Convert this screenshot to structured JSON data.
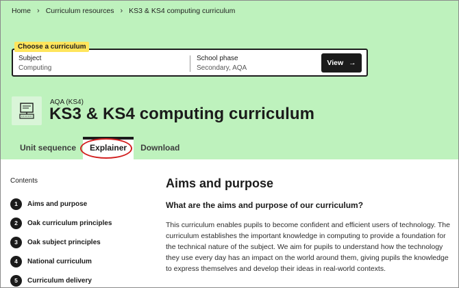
{
  "breadcrumb": {
    "items": [
      "Home",
      "Curriculum resources",
      "KS3 & KS4 computing curriculum"
    ],
    "separator": "›"
  },
  "chooser": {
    "tag": "Choose a curriculum",
    "subject_label": "Subject",
    "subject_value": "Computing",
    "phase_label": "School phase",
    "phase_value": "Secondary, AQA",
    "view_label": "View",
    "view_icon": "→"
  },
  "header": {
    "icon": "computer-icon",
    "exam_board": "AQA (KS4)",
    "title": "KS3 & KS4 computing curriculum"
  },
  "tabs": [
    {
      "label": "Unit sequence",
      "active": false
    },
    {
      "label": "Explainer",
      "active": true
    },
    {
      "label": "Download",
      "active": false
    }
  ],
  "sidebar": {
    "title": "Contents",
    "items": [
      {
        "num": "1",
        "label": "Aims and purpose"
      },
      {
        "num": "2",
        "label": "Oak curriculum principles"
      },
      {
        "num": "3",
        "label": "Oak subject principles"
      },
      {
        "num": "4",
        "label": "National curriculum"
      },
      {
        "num": "5",
        "label": "Curriculum delivery"
      }
    ]
  },
  "main": {
    "heading": "Aims and purpose",
    "subheading": "What are the aims and purpose of our curriculum?",
    "paragraph": "This curriculum enables pupils to become confident and efficient users of technology. The curriculum establishes the important knowledge in computing to provide a foundation for the technical nature of the subject. We aim for pupils to understand how the technology they use every day has an impact on the world around them, giving pupils the knowledge to express themselves and develop their ideas in real-world contexts."
  },
  "colors": {
    "hero_bg": "#bef2bd",
    "tag_bg": "#ffe55c",
    "highlight_ring": "#d21f1f",
    "dark": "#1b1b1b"
  }
}
